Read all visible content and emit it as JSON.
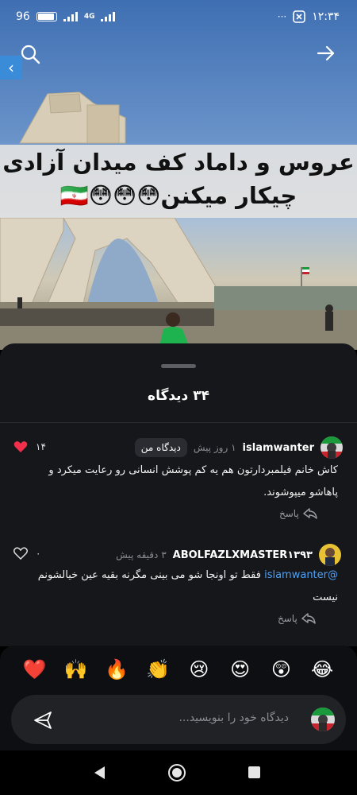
{
  "status": {
    "battery": "96",
    "network": "4G",
    "time": "۱۲:۳۴",
    "more": "···"
  },
  "post": {
    "caption_line1": "عروس و داماد کف میدان آزادی",
    "caption_line2": "چیکار میکنن😳😳😳🇮🇷"
  },
  "comments_sheet": {
    "title": "۳۴ دیدگاه",
    "comments": [
      {
        "username": "islamwanter",
        "time": "۱ روز پیش",
        "badge": "دیدگاه من",
        "text": "کاش خانم فیلمبردارتون هم یه کم پوشش انسانی رو رعایت میکرد و پاهاشو میپوشوند.",
        "reply_label": "پاسخ",
        "likes": "۱۴",
        "liked": true
      },
      {
        "username": "ABOLFAZLXMASTER۱۳۹۳",
        "time": "۳ دقیقه پیش",
        "mention": "@islamwanter",
        "text": "فقط تو اونجا شو می بینی مگرنه بقیه عین خیالشونم نیست",
        "reply_label": "پاسخ",
        "likes": "۰",
        "liked": false
      }
    ]
  },
  "composer": {
    "reactions": [
      "❤️",
      "🙌",
      "🔥",
      "👏",
      "😢",
      "😍",
      "😲",
      "😂"
    ],
    "placeholder": "دیدگاه خود را بنویسید..."
  },
  "colors": {
    "sheet_bg": "#16171b",
    "like_red": "#f0304a",
    "mention_blue": "#4ea1f5",
    "side_tab_blue": "#3a8bd8"
  }
}
